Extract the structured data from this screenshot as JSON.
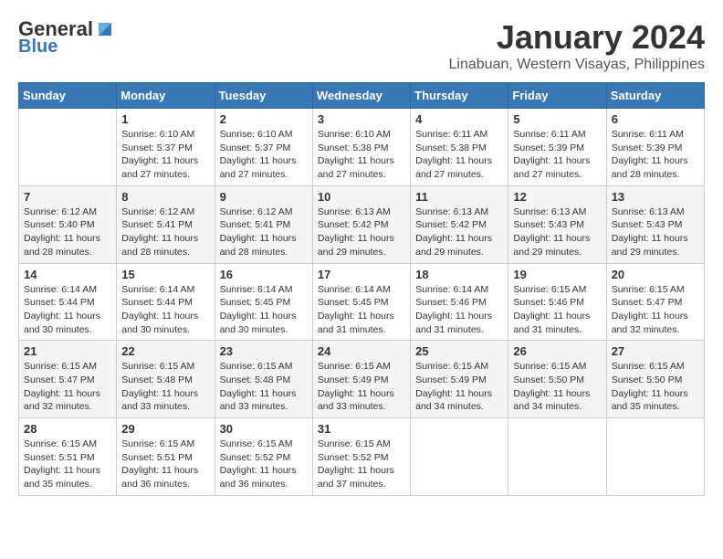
{
  "header": {
    "logo_line1": "General",
    "logo_line2": "Blue",
    "main_title": "January 2024",
    "subtitle": "Linabuan, Western Visayas, Philippines"
  },
  "calendar": {
    "days_of_week": [
      "Sunday",
      "Monday",
      "Tuesday",
      "Wednesday",
      "Thursday",
      "Friday",
      "Saturday"
    ],
    "weeks": [
      [
        {
          "day": "",
          "detail": ""
        },
        {
          "day": "1",
          "detail": "Sunrise: 6:10 AM\nSunset: 5:37 PM\nDaylight: 11 hours\nand 27 minutes."
        },
        {
          "day": "2",
          "detail": "Sunrise: 6:10 AM\nSunset: 5:37 PM\nDaylight: 11 hours\nand 27 minutes."
        },
        {
          "day": "3",
          "detail": "Sunrise: 6:10 AM\nSunset: 5:38 PM\nDaylight: 11 hours\nand 27 minutes."
        },
        {
          "day": "4",
          "detail": "Sunrise: 6:11 AM\nSunset: 5:38 PM\nDaylight: 11 hours\nand 27 minutes."
        },
        {
          "day": "5",
          "detail": "Sunrise: 6:11 AM\nSunset: 5:39 PM\nDaylight: 11 hours\nand 27 minutes."
        },
        {
          "day": "6",
          "detail": "Sunrise: 6:11 AM\nSunset: 5:39 PM\nDaylight: 11 hours\nand 28 minutes."
        }
      ],
      [
        {
          "day": "7",
          "detail": "Sunrise: 6:12 AM\nSunset: 5:40 PM\nDaylight: 11 hours\nand 28 minutes."
        },
        {
          "day": "8",
          "detail": "Sunrise: 6:12 AM\nSunset: 5:41 PM\nDaylight: 11 hours\nand 28 minutes."
        },
        {
          "day": "9",
          "detail": "Sunrise: 6:12 AM\nSunset: 5:41 PM\nDaylight: 11 hours\nand 28 minutes."
        },
        {
          "day": "10",
          "detail": "Sunrise: 6:13 AM\nSunset: 5:42 PM\nDaylight: 11 hours\nand 29 minutes."
        },
        {
          "day": "11",
          "detail": "Sunrise: 6:13 AM\nSunset: 5:42 PM\nDaylight: 11 hours\nand 29 minutes."
        },
        {
          "day": "12",
          "detail": "Sunrise: 6:13 AM\nSunset: 5:43 PM\nDaylight: 11 hours\nand 29 minutes."
        },
        {
          "day": "13",
          "detail": "Sunrise: 6:13 AM\nSunset: 5:43 PM\nDaylight: 11 hours\nand 29 minutes."
        }
      ],
      [
        {
          "day": "14",
          "detail": "Sunrise: 6:14 AM\nSunset: 5:44 PM\nDaylight: 11 hours\nand 30 minutes."
        },
        {
          "day": "15",
          "detail": "Sunrise: 6:14 AM\nSunset: 5:44 PM\nDaylight: 11 hours\nand 30 minutes."
        },
        {
          "day": "16",
          "detail": "Sunrise: 6:14 AM\nSunset: 5:45 PM\nDaylight: 11 hours\nand 30 minutes."
        },
        {
          "day": "17",
          "detail": "Sunrise: 6:14 AM\nSunset: 5:45 PM\nDaylight: 11 hours\nand 31 minutes."
        },
        {
          "day": "18",
          "detail": "Sunrise: 6:14 AM\nSunset: 5:46 PM\nDaylight: 11 hours\nand 31 minutes."
        },
        {
          "day": "19",
          "detail": "Sunrise: 6:15 AM\nSunset: 5:46 PM\nDaylight: 11 hours\nand 31 minutes."
        },
        {
          "day": "20",
          "detail": "Sunrise: 6:15 AM\nSunset: 5:47 PM\nDaylight: 11 hours\nand 32 minutes."
        }
      ],
      [
        {
          "day": "21",
          "detail": "Sunrise: 6:15 AM\nSunset: 5:47 PM\nDaylight: 11 hours\nand 32 minutes."
        },
        {
          "day": "22",
          "detail": "Sunrise: 6:15 AM\nSunset: 5:48 PM\nDaylight: 11 hours\nand 33 minutes."
        },
        {
          "day": "23",
          "detail": "Sunrise: 6:15 AM\nSunset: 5:48 PM\nDaylight: 11 hours\nand 33 minutes."
        },
        {
          "day": "24",
          "detail": "Sunrise: 6:15 AM\nSunset: 5:49 PM\nDaylight: 11 hours\nand 33 minutes."
        },
        {
          "day": "25",
          "detail": "Sunrise: 6:15 AM\nSunset: 5:49 PM\nDaylight: 11 hours\nand 34 minutes."
        },
        {
          "day": "26",
          "detail": "Sunrise: 6:15 AM\nSunset: 5:50 PM\nDaylight: 11 hours\nand 34 minutes."
        },
        {
          "day": "27",
          "detail": "Sunrise: 6:15 AM\nSunset: 5:50 PM\nDaylight: 11 hours\nand 35 minutes."
        }
      ],
      [
        {
          "day": "28",
          "detail": "Sunrise: 6:15 AM\nSunset: 5:51 PM\nDaylight: 11 hours\nand 35 minutes."
        },
        {
          "day": "29",
          "detail": "Sunrise: 6:15 AM\nSunset: 5:51 PM\nDaylight: 11 hours\nand 36 minutes."
        },
        {
          "day": "30",
          "detail": "Sunrise: 6:15 AM\nSunset: 5:52 PM\nDaylight: 11 hours\nand 36 minutes."
        },
        {
          "day": "31",
          "detail": "Sunrise: 6:15 AM\nSunset: 5:52 PM\nDaylight: 11 hours\nand 37 minutes."
        },
        {
          "day": "",
          "detail": ""
        },
        {
          "day": "",
          "detail": ""
        },
        {
          "day": "",
          "detail": ""
        }
      ]
    ]
  }
}
